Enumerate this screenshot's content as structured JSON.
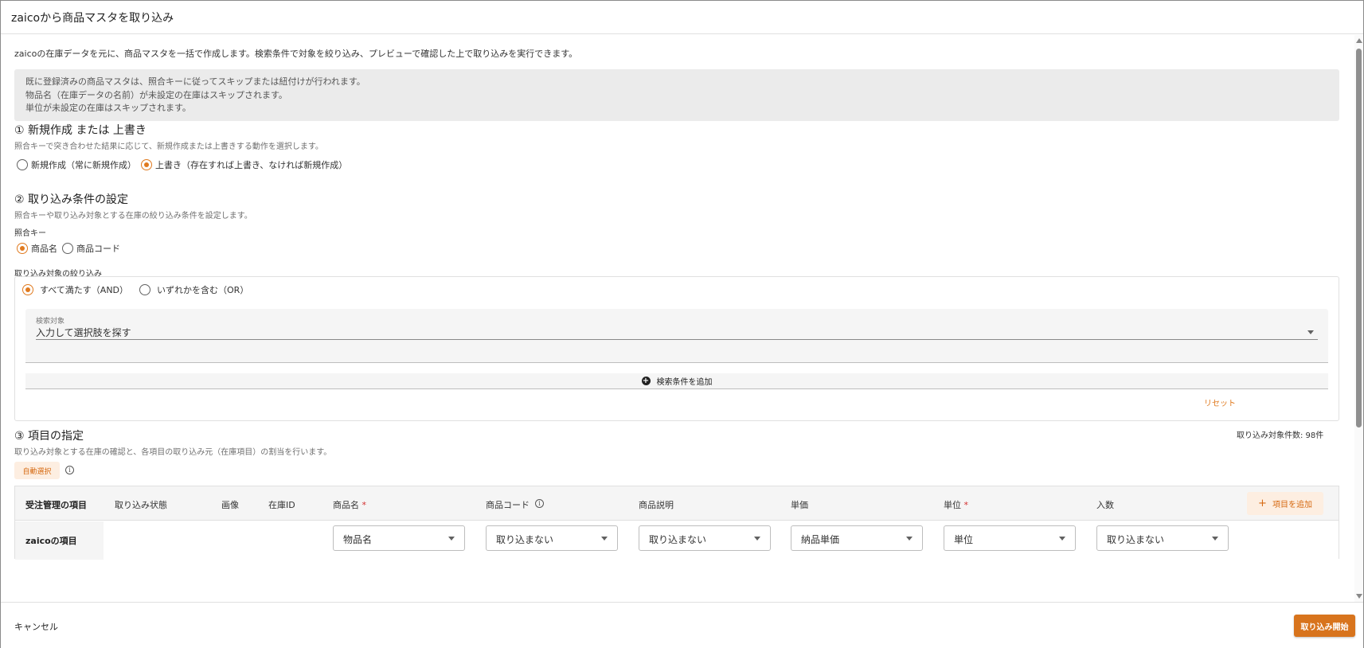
{
  "dialog": {
    "title": "zaicoから商品マスタを取り込み"
  },
  "intro": "zaicoの在庫データを元に、商品マスタを一括で作成します。検索条件で対象を絞り込み、プレビューで確認した上で取り込みを実行できます。",
  "notice": [
    "既に登録済みの商品マスタは、照合キーに従ってスキップまたは紐付けが行われます。",
    "物品名（在庫データの名前）が未設定の在庫はスキップされます。",
    "単位が未設定の在庫はスキップされます。"
  ],
  "section1": {
    "title": "① 新規作成 または 上書き",
    "desc": "照合キーで突き合わせた結果に応じて、新規作成または上書きする動作を選択します。",
    "options": [
      {
        "label": "新規作成（常に新規作成）",
        "selected": false
      },
      {
        "label": "上書き（存在すれば上書き、なければ新規作成）",
        "selected": true
      }
    ]
  },
  "section2": {
    "title": "② 取り込み条件の設定",
    "desc": "照合キーや取り込み対象とする在庫の絞り込み条件を設定します。",
    "key_label": "照合キー",
    "key_options": [
      {
        "label": "商品名",
        "selected": true
      },
      {
        "label": "商品コード",
        "selected": false
      }
    ],
    "filter_label": "取り込み対象の絞り込み",
    "match_options": [
      {
        "label": "すべて満たす（AND）",
        "selected": true
      },
      {
        "label": "いずれかを含む（OR）",
        "selected": false
      }
    ],
    "search_field_label": "検索対象",
    "search_field_placeholder": "入力して選択肢を探す",
    "add_condition": "検索条件を追加",
    "reset": "リセット"
  },
  "section3": {
    "title": "③ 項目の指定",
    "desc": "取り込み対象とする在庫の確認と、各項目の取り込み元（在庫項目）の割当を行います。",
    "count": "取り込み対象件数: 98件",
    "auto_select": "自動選択",
    "add_item": "項目を追加",
    "columns": {
      "order_item": "受注管理の項目",
      "status": "取り込み状態",
      "image": "画像",
      "stock_id": "在庫ID",
      "name": "商品名",
      "code": "商品コード",
      "desc": "商品説明",
      "price": "単価",
      "unit": "単位",
      "quantity": "入数"
    },
    "required_mark": "*",
    "row_label": "zaicoの項目",
    "selects": {
      "name": "物品名",
      "code": "取り込まない",
      "desc": "取り込まない",
      "price": "納品単価",
      "unit": "単位",
      "quantity": "取り込まない"
    }
  },
  "footer": {
    "cancel": "キャンセル",
    "start": "取り込み開始"
  },
  "colors": {
    "accent": "#e07a1f",
    "accent_bg": "#fdeee1",
    "primary_button": "#d8741d"
  },
  "icons": {
    "info": "info-icon",
    "plus": "plus-circle-icon",
    "dropdown": "chevron-down-icon"
  }
}
